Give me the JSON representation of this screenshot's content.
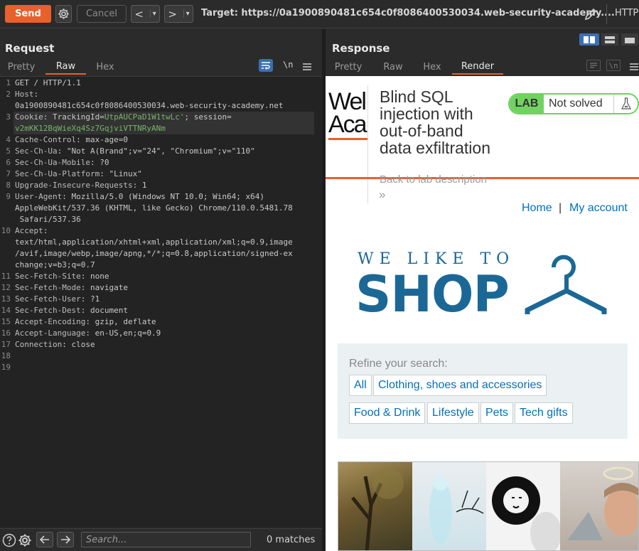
{
  "toolbar": {
    "send_label": "Send",
    "cancel_label": "Cancel",
    "back_glyph": "<",
    "forward_glyph": ">",
    "dropdown_glyph": "▾",
    "target_label": "Target: https://0a1900890481c654c0f8086400530034.web-security-academy....",
    "protocol_label": "HTTP"
  },
  "request": {
    "title": "Request",
    "tabs": [
      "Pretty",
      "Raw",
      "Hex"
    ],
    "active_tab": "Raw",
    "newline_toggle": "\\n",
    "lines": [
      {
        "n": "1",
        "text": "GET / HTTP/1.1"
      },
      {
        "n": "2",
        "key": "Host",
        "val": ""
      },
      {
        "n": "",
        "text": "0a1900890481c654c0f8086400530034.web-security-academy.net"
      },
      {
        "n": "3",
        "key": "Cookie",
        "val": ""
      },
      {
        "n": "",
        "text": "v2mKK12BqWieXq4Sz7GqjviVTTNRyANm"
      },
      {
        "n": "4",
        "key": "Cache-Control",
        "val": " max-age=0"
      },
      {
        "n": "5",
        "key": "Sec-Ch-Ua",
        "val": " \"Not A(Brand\";v=\"24\", \"Chromium\";v=\"110\""
      },
      {
        "n": "6",
        "key": "Sec-Ch-Ua-Mobile",
        "val": " ?0"
      },
      {
        "n": "7",
        "key": "Sec-Ch-Ua-Platform",
        "val": " \"Linux\""
      },
      {
        "n": "8",
        "key": "Upgrade-Insecure-Requests",
        "val": " 1"
      },
      {
        "n": "9",
        "key": "User-Agent",
        "val": " Mozilla/5.0 (Windows NT 10.0; Win64; x64)"
      },
      {
        "n": "",
        "text": "AppleWebKit/537.36 (KHTML, like Gecko) Chrome/110.0.5481.78"
      },
      {
        "n": "",
        "text": " Safari/537.36"
      },
      {
        "n": "10",
        "key": "Accept",
        "val": ""
      },
      {
        "n": "",
        "text": "text/html,application/xhtml+xml,application/xml;q=0.9,image"
      },
      {
        "n": "",
        "text": "/avif,image/webp,image/apng,*/*;q=0.8,application/signed-ex"
      },
      {
        "n": "",
        "text": "change;v=b3;q=0.7"
      },
      {
        "n": "11",
        "key": "Sec-Fetch-Site",
        "val": " none"
      },
      {
        "n": "12",
        "key": "Sec-Fetch-Mode",
        "val": " navigate"
      },
      {
        "n": "13",
        "key": "Sec-Fetch-User",
        "val": " ?1"
      },
      {
        "n": "14",
        "key": "Sec-Fetch-Dest",
        "val": " document"
      },
      {
        "n": "15",
        "key": "Accept-Encoding",
        "val": " gzip, deflate"
      },
      {
        "n": "16",
        "key": "Accept-Language",
        "val": " en-US,en;q=0.9"
      },
      {
        "n": "17",
        "key": "Connection",
        "val": " close"
      },
      {
        "n": "18",
        "text": ""
      },
      {
        "n": "19",
        "text": ""
      }
    ],
    "cookie": {
      "key": "Cookie",
      "name1": "TrackingId",
      "value1": "UtpAUCPaD1W1twLc'",
      "sep": "; ",
      "name2": "session",
      "eq": "="
    },
    "search_placeholder": "Search...",
    "matches": "0 matches"
  },
  "response": {
    "title": "Response",
    "tabs": [
      "Pretty",
      "Raw",
      "Hex",
      "Render"
    ],
    "active_tab": "Render",
    "newline_toggle": "\\n"
  },
  "render": {
    "logo_text_1": "Wel",
    "logo_text_2": "Aca",
    "lab_title_lines": [
      "Blind SQL",
      "injection with",
      "out-of-band",
      "data exfiltration"
    ],
    "back_link": "Back to lab description",
    "back_chevron": "»",
    "lab_badge": "LAB",
    "lab_status": "Not solved",
    "nav_home": "Home",
    "nav_sep": "|",
    "nav_account": "My account",
    "shop_tagline": "WE LIKE TO",
    "shop_word": "SHOP",
    "refine_label": "Refine your search:",
    "filters": [
      "All",
      "Clothing, shoes and accessories",
      "Food & Drink",
      "Lifestyle",
      "Pets",
      "Tech gifts"
    ],
    "colors": {
      "accent": "#e8602c",
      "lab_green": "#70d25f",
      "shop_blue": "#1b6896",
      "link": "#0071bc"
    }
  }
}
